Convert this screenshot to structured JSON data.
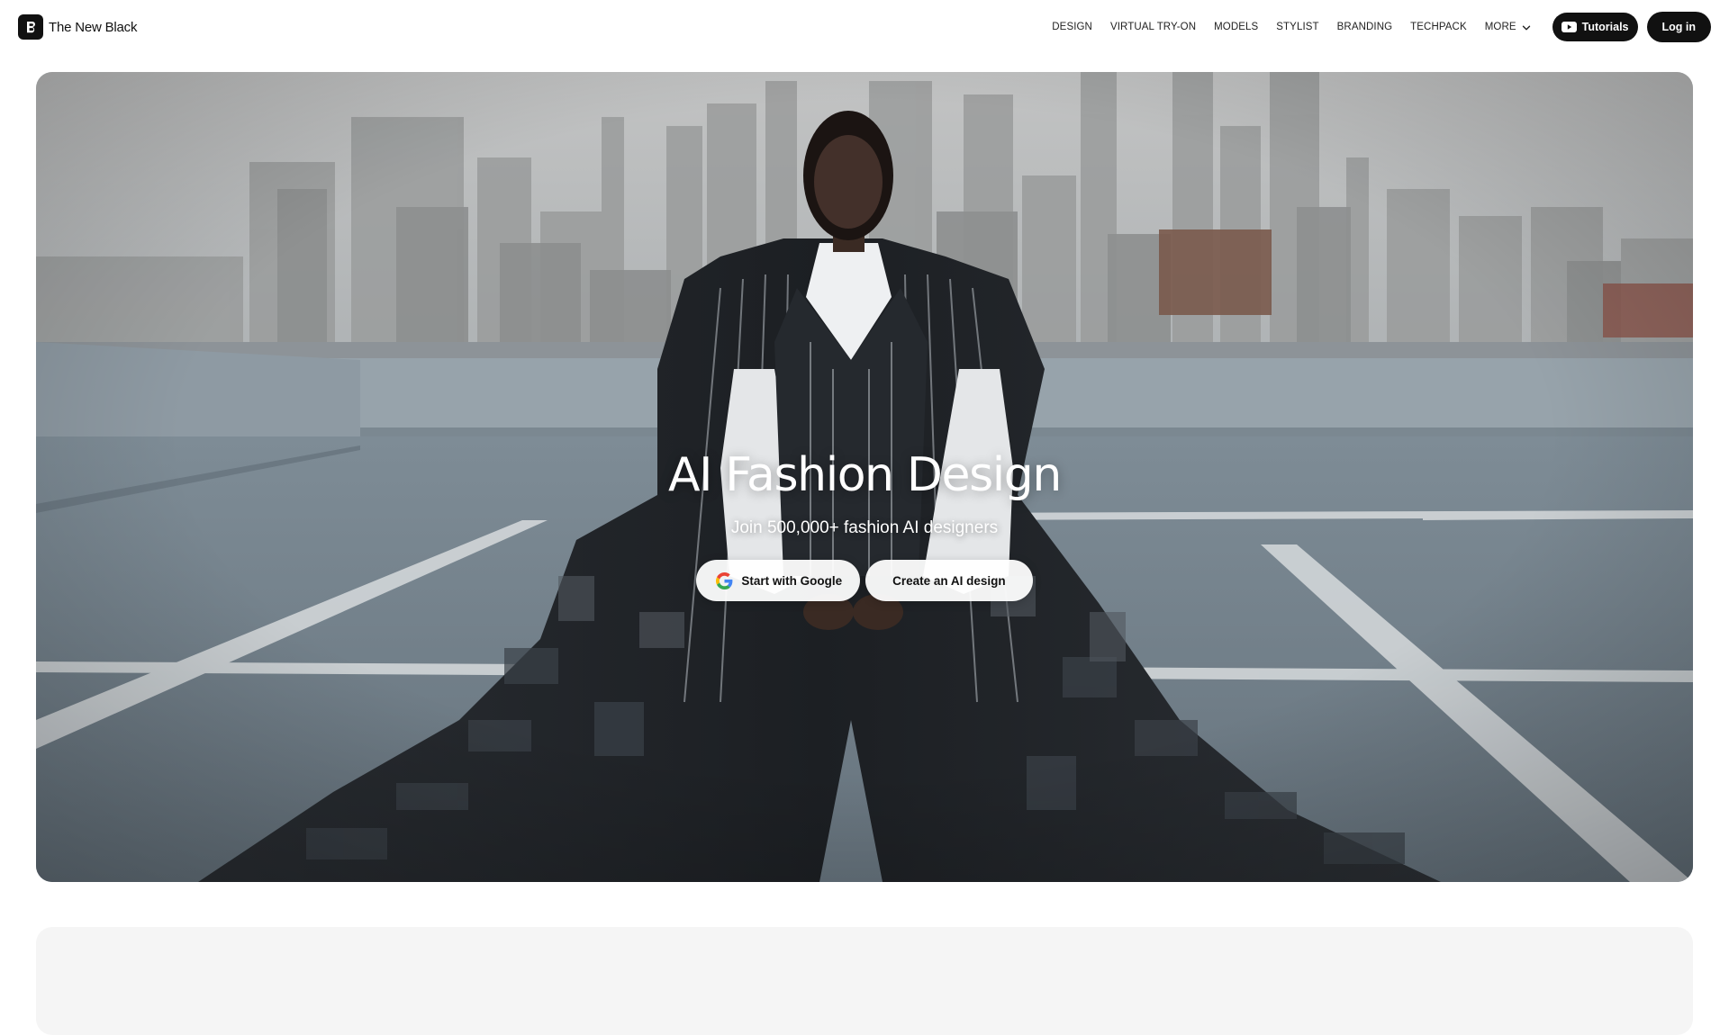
{
  "header": {
    "brand_name": "The New Black",
    "nav": {
      "design": "DESIGN",
      "virtual_try_on": "VIRTUAL TRY-ON",
      "models": "MODELS",
      "stylist": "STYLIST",
      "branding": "BRANDING",
      "techpack": "TECHPACK",
      "more": "MORE"
    },
    "tutorials_label": "Tutorials",
    "login_label": "Log in"
  },
  "hero": {
    "title": "AI Fashion Design",
    "subtitle": "Join 500,000+ fashion AI designers",
    "google_button_label": "Start with Google",
    "create_button_label": "Create an AI design"
  },
  "colors": {
    "brand": "#111111",
    "button_light": "#ffffff",
    "lower_card": "#f5f5f5"
  },
  "icons": {
    "brand_logo": "brand-logo-icon",
    "more_chevron": "chevron-down-icon",
    "tutorials": "youtube-icon",
    "google": "google-icon"
  }
}
